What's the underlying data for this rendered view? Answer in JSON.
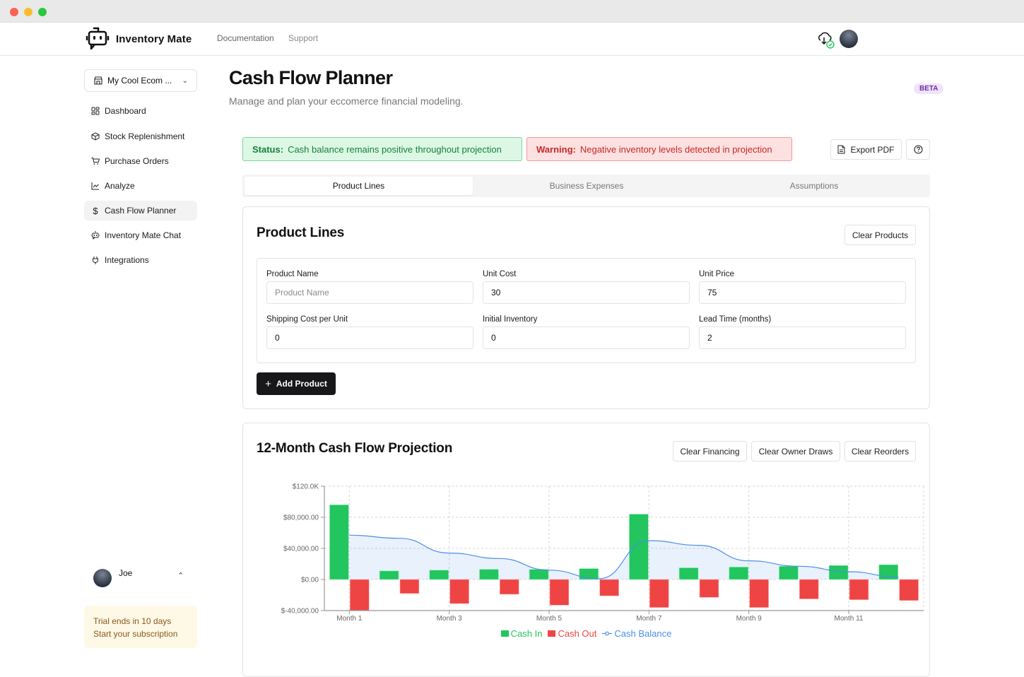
{
  "window": {
    "controls": [
      "close",
      "minimize",
      "maximize"
    ]
  },
  "topnav": {
    "brand": "Inventory Mate",
    "links": [
      "Documentation",
      "Support"
    ],
    "sync_icon": "cloud-sync-check-icon"
  },
  "sidebar": {
    "store": {
      "label": "My Cool Ecom ...",
      "icon": "store-icon"
    },
    "items": [
      {
        "label": "Dashboard",
        "icon": "dashboard-grid-icon",
        "active": false
      },
      {
        "label": "Stock Replenishment",
        "icon": "package-icon",
        "active": false
      },
      {
        "label": "Purchase Orders",
        "icon": "cart-icon",
        "active": false
      },
      {
        "label": "Analyze",
        "icon": "line-chart-icon",
        "active": false
      },
      {
        "label": "Cash Flow Planner",
        "icon": "dollar-icon",
        "active": true
      },
      {
        "label": "Inventory Mate Chat",
        "icon": "bot-chat-icon",
        "active": false
      },
      {
        "label": "Integrations",
        "icon": "plug-icon",
        "active": false
      }
    ],
    "user": {
      "name": "Joe"
    },
    "trial": {
      "line1": "Trial ends in 10 days",
      "line2": "Start your subscription"
    }
  },
  "header": {
    "title": "Cash Flow Planner",
    "subtitle": "Manage and plan your eccomerce financial modeling.",
    "badge": "BETA"
  },
  "alerts": {
    "status": {
      "label": "Status:",
      "text": "Cash balance remains positive throughout projection",
      "color": "#17803d"
    },
    "warning": {
      "label": "Warning:",
      "text": "Negative inventory levels detected in projection",
      "color": "#c62828"
    }
  },
  "toolbar": {
    "export_label": "Export PDF",
    "help_icon": "help-circle-icon"
  },
  "tabs": [
    {
      "label": "Product Lines",
      "active": true
    },
    {
      "label": "Business Expenses",
      "active": false
    },
    {
      "label": "Assumptions",
      "active": false
    }
  ],
  "product_lines": {
    "title": "Product Lines",
    "clear_label": "Clear Products",
    "fields": {
      "product_name": {
        "label": "Product Name",
        "value": "",
        "placeholder": "Product Name"
      },
      "unit_cost": {
        "label": "Unit Cost",
        "value": "30"
      },
      "unit_price": {
        "label": "Unit Price",
        "value": "75"
      },
      "shipping_cost": {
        "label": "Shipping Cost per Unit",
        "value": "0"
      },
      "initial_inventory": {
        "label": "Initial Inventory",
        "value": "0"
      },
      "lead_time": {
        "label": "Lead Time (months)",
        "value": "2"
      }
    },
    "add_label": "Add Product"
  },
  "projection": {
    "title": "12-Month Cash Flow Projection",
    "buttons": [
      "Clear Financing",
      "Clear Owner Draws",
      "Clear Reorders"
    ]
  },
  "chart_data": {
    "type": "bar",
    "title": "12-Month Cash Flow Projection",
    "categories": [
      "Month 1",
      "Month 2",
      "Month 3",
      "Month 4",
      "Month 5",
      "Month 6",
      "Month 7",
      "Month 8",
      "Month 9",
      "Month 10",
      "Month 11",
      "Month 12"
    ],
    "x_tick_labels": [
      "Month 1",
      "Month 3",
      "Month 5",
      "Month 7",
      "Month 9",
      "Month 11"
    ],
    "y_tick_labels": [
      "$120.0K",
      "$80,000.00",
      "$40,000.00",
      "$0.00",
      "$-40,000.00"
    ],
    "ylim": [
      -40000,
      120000
    ],
    "y_ticks": [
      120000,
      80000,
      40000,
      0,
      -40000
    ],
    "grid": true,
    "legend_position": "bottom",
    "series": [
      {
        "name": "Cash In",
        "type": "bar",
        "color": "#22c55e",
        "values": [
          96000,
          11000,
          12000,
          13000,
          13000,
          14000,
          84000,
          15000,
          16000,
          17000,
          18000,
          19000
        ]
      },
      {
        "name": "Cash Out",
        "type": "bar",
        "color": "#ef4444",
        "values": [
          -40000,
          -18000,
          -31000,
          -19000,
          -33000,
          -21000,
          -36000,
          -23000,
          -36000,
          -25000,
          -26000,
          -27000
        ]
      },
      {
        "name": "Cash Balance",
        "type": "area-line",
        "color": "#4a8fe8",
        "values": [
          57000,
          53000,
          34000,
          27000,
          12000,
          1000,
          50000,
          44000,
          24000,
          17000,
          10000,
          3000
        ]
      }
    ]
  }
}
